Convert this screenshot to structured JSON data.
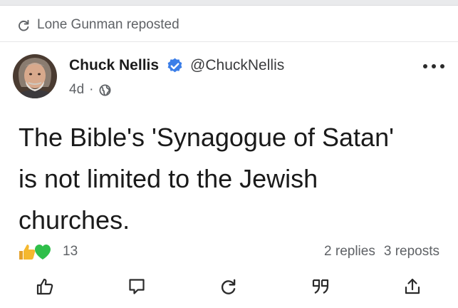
{
  "repost": {
    "label": "Lone Gunman reposted",
    "icon": "repost-icon"
  },
  "author": {
    "name": "Chuck Nellis",
    "handle": "@ChuckNellis",
    "verified_icon": "verified-badge-icon",
    "verified_color": "#3b7ee8"
  },
  "meta": {
    "age": "4d",
    "separator": "·",
    "visibility_icon": "globe-icon"
  },
  "post": {
    "lines": [
      "The Bible's 'Synagogue of Satan'",
      "is not limited to the Jewish",
      "churches."
    ]
  },
  "reactions": {
    "icons": [
      "thumbs-up-icon",
      "green-heart-icon"
    ],
    "count": "13",
    "like_color": "#f5b82e",
    "heart_color": "#2fbf4a"
  },
  "stats": {
    "replies": "2 replies",
    "reposts": "3 reposts"
  },
  "actions": [
    {
      "name": "like",
      "icon": "thumbs-up-outline-icon"
    },
    {
      "name": "comment",
      "icon": "comment-icon"
    },
    {
      "name": "repost",
      "icon": "repost-icon"
    },
    {
      "name": "quote",
      "icon": "quote-icon"
    },
    {
      "name": "share",
      "icon": "share-icon"
    }
  ]
}
